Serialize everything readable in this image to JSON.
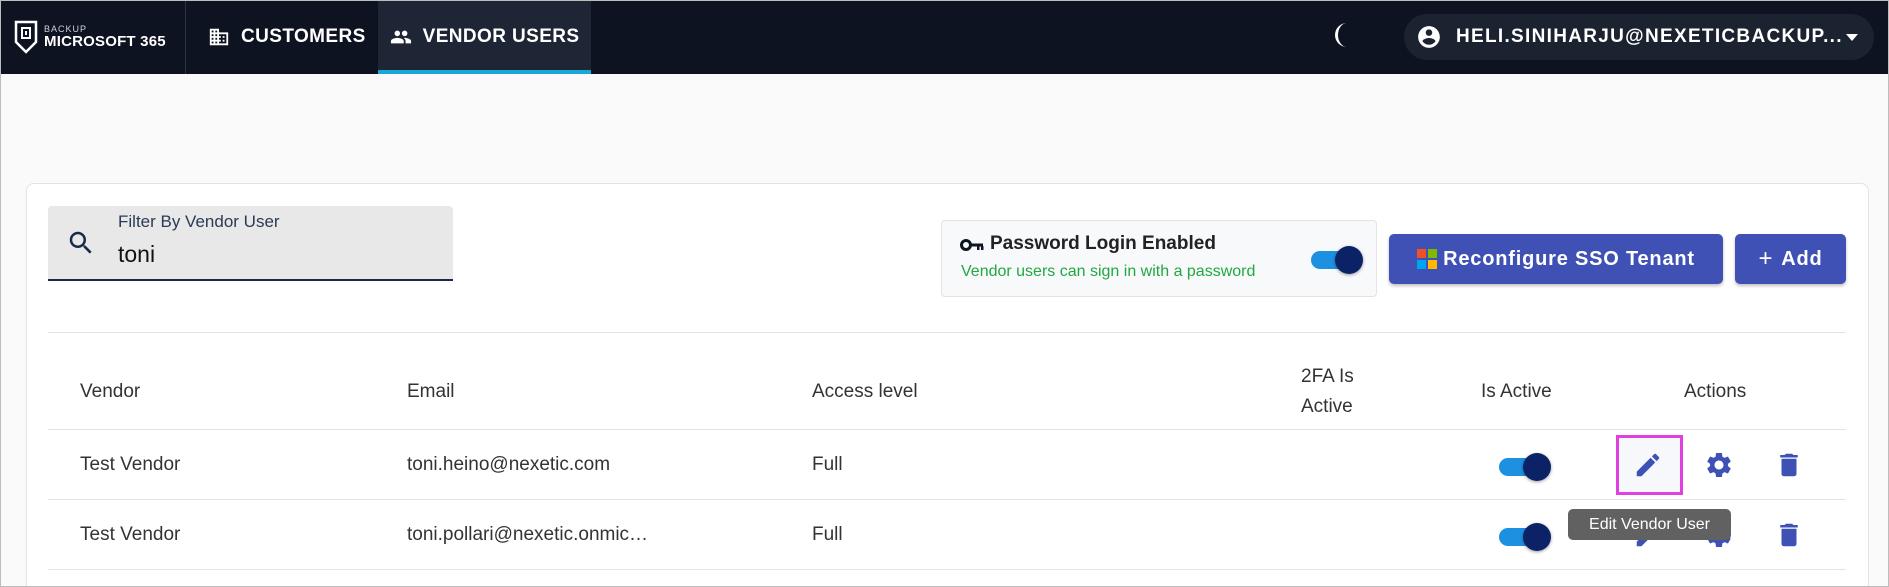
{
  "brand": {
    "small": "BACKUP",
    "name": "MICROSOFT 365"
  },
  "nav": {
    "customers": "CUSTOMERS",
    "vendor_users": "VENDOR USERS"
  },
  "user": {
    "email": "HELI.SINIHARJU@NEXETICBACKUP..."
  },
  "filter": {
    "label": "Filter By Vendor User",
    "value": "toni"
  },
  "password_login": {
    "title": "Password Login Enabled",
    "subtitle": "Vendor users can sign in with a password",
    "enabled": true
  },
  "buttons": {
    "sso": "Reconfigure SSO Tenant",
    "add": "Add"
  },
  "table": {
    "headers": {
      "vendor": "Vendor",
      "email": "Email",
      "access": "Access level",
      "twofa_line1": "2FA Is",
      "twofa_line2": "Active",
      "is_active": "Is Active",
      "actions": "Actions"
    },
    "rows": [
      {
        "vendor": "Test Vendor",
        "email": "toni.heino@nexetic.com",
        "access": "Full",
        "is_active": true
      },
      {
        "vendor": "Test Vendor",
        "email": "toni.pollari@nexetic.onmic…",
        "access": "Full",
        "is_active": true
      }
    ]
  },
  "tooltip": "Edit Vendor User",
  "colors": {
    "topbar": "#0d1320",
    "accent": "#3f51b5",
    "active_tab_underline": "#1aa7d8",
    "success_text": "#21a841",
    "highlight": "#e040e0"
  },
  "icons": [
    "shield-logo-icon",
    "building-icon",
    "people-icon",
    "moon-icon",
    "account-circle-icon",
    "chevron-down-icon",
    "search-icon",
    "key-icon",
    "microsoft-logo-icon",
    "plus-icon",
    "pencil-icon",
    "gear-icon",
    "trash-icon"
  ]
}
